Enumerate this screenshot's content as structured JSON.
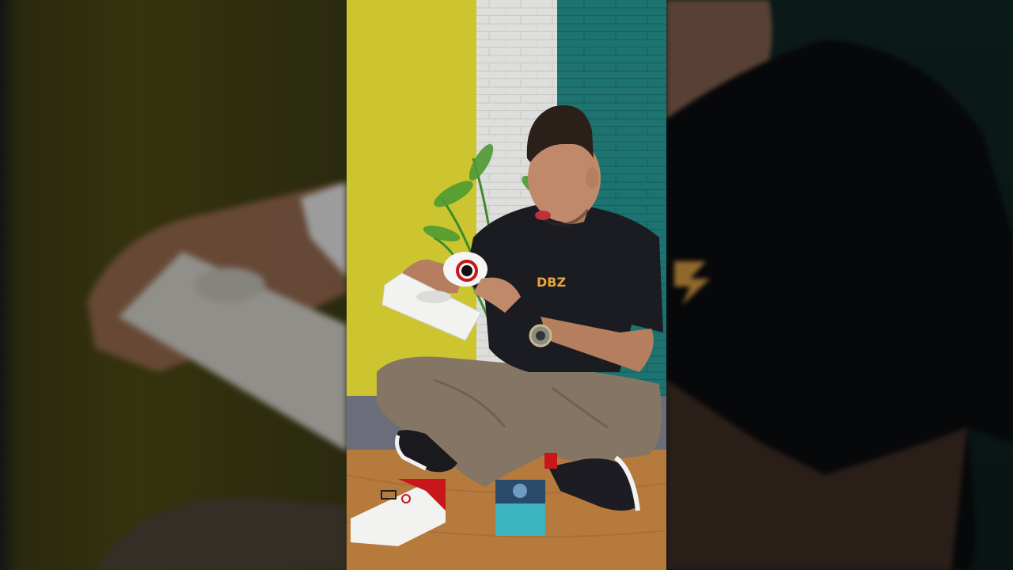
{
  "video": {
    "shirt_text": "DBZ",
    "colors": {
      "wall_yellow": "#d9d233",
      "wall_white": "#ededea",
      "wall_teal": "#1f7b78",
      "desk": "#b67a3d",
      "shirt": "#1a1c22",
      "trousers": "#857565",
      "box_white": "#f2f2f0",
      "box_red": "#c8161b",
      "box_teal": "#3bb4c0"
    }
  }
}
